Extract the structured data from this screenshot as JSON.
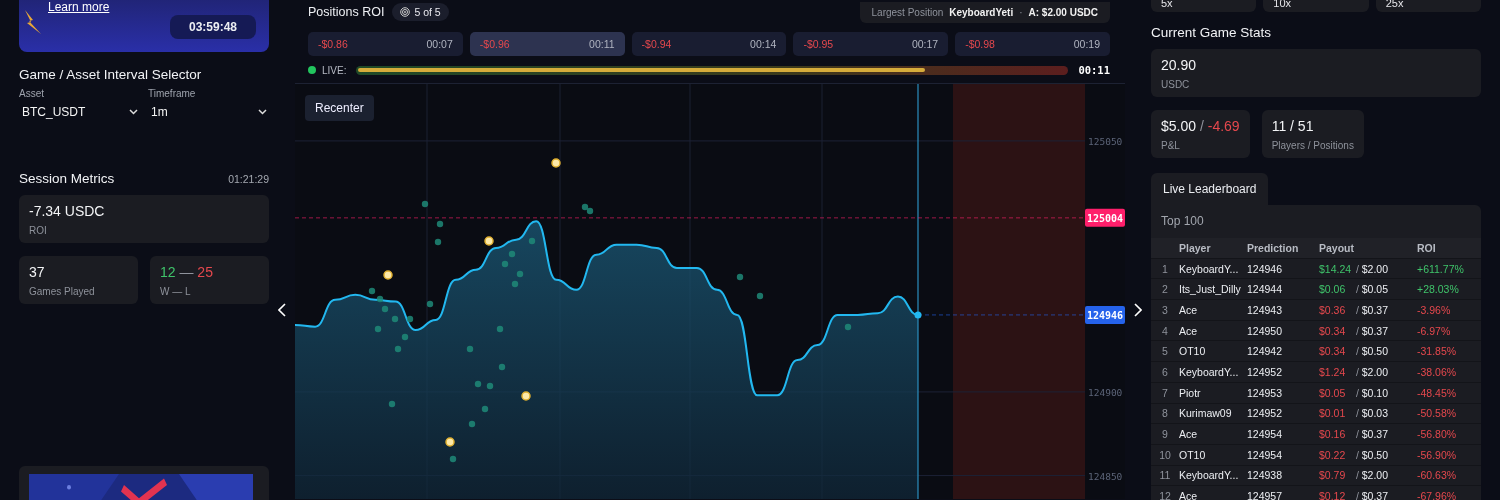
{
  "banner": {
    "link": "Learn more",
    "timer": "03:59:48"
  },
  "selector": {
    "title": "Game / Asset Interval Selector",
    "fields": [
      {
        "label": "Asset",
        "value": "BTC_USDT"
      },
      {
        "label": "Timeframe",
        "value": "1m"
      }
    ]
  },
  "session": {
    "title": "Session Metrics",
    "time": "01:21:29",
    "roi": {
      "value": "-7.34 USDC",
      "label": "ROI"
    },
    "games": {
      "value": "37",
      "label": "Games Played"
    },
    "record": {
      "wins": "12",
      "separator": "—",
      "losses": "25",
      "label": "W — L"
    }
  },
  "positions": {
    "title": "Positions ROI",
    "count": "5 of 5",
    "largest": {
      "label": "Largest Position",
      "player": "KeyboardYeti",
      "separator": "·",
      "amount": "A: $2.00 USDC"
    },
    "cards": [
      {
        "roi": "-$0.86",
        "time": "00:07",
        "profit": false,
        "selected": false
      },
      {
        "roi": "-$0.96",
        "time": "00:11",
        "profit": false,
        "selected": true
      },
      {
        "roi": "-$0.94",
        "time": "00:14",
        "profit": false,
        "selected": false
      },
      {
        "roi": "-$0.95",
        "time": "00:17",
        "profit": false,
        "selected": false
      },
      {
        "roi": "-$0.98",
        "time": "00:19",
        "profit": false,
        "selected": false
      }
    ],
    "live": {
      "label": "LIVE:",
      "level": 0.8,
      "time": "00:11"
    }
  },
  "chart": {
    "button": "Recenter",
    "chart_data": {
      "type": "area",
      "grid": true,
      "ylim": [
        124836,
        125084
      ],
      "yticks": [
        124850,
        124900,
        125050
      ],
      "series": [
        {
          "color": "#22b8f0",
          "values": [
            124940,
            124939,
            124955,
            124958,
            124955,
            124954,
            124937,
            124943,
            124967,
            124973,
            124986,
            124991,
            125002,
            124967,
            124961,
            124982,
            124988,
            124988,
            124986,
            124974,
            124974,
            124961,
            124946,
            124898,
            124898,
            124919,
            124928,
            124946,
            124946,
            124947,
            124957,
            124946
          ]
        }
      ],
      "ref_lines": [
        {
          "axis": "y",
          "value": 125004,
          "label": "125004",
          "color": "#ff1f6b"
        },
        {
          "axis": "y",
          "value": 124946,
          "label": "124946",
          "color": "#2563eb"
        }
      ]
    }
  },
  "multipliers": [
    "5x",
    "10x",
    "25x"
  ],
  "stats": {
    "title": "Current Game Stats",
    "pool": {
      "value": "20.90",
      "label": "USDC"
    },
    "pnl": {
      "stake": "$5.00",
      "separator": "/",
      "result": "-4.69",
      "profit": false,
      "label": "P&L"
    },
    "players": {
      "value": "11 / 51",
      "label": "Players / Positions"
    }
  },
  "leaderboard": {
    "tab": "Live Leaderboard",
    "subtitle": "Top 100",
    "columns": [
      "Player",
      "Prediction",
      "Payout",
      "ROI"
    ],
    "rows": [
      {
        "rank": "1",
        "player": "KeyboardY...",
        "prediction": "124946",
        "payout": "$14.24",
        "separator": "/",
        "stake": "$2.00",
        "roi": "+611.77%",
        "profit": true
      },
      {
        "rank": "2",
        "player": "Its_Just_Dilly",
        "prediction": "124944",
        "payout": "$0.06",
        "separator": "/",
        "stake": "$0.05",
        "roi": "+28.03%",
        "profit": true
      },
      {
        "rank": "3",
        "player": "Ace",
        "prediction": "124943",
        "payout": "$0.36",
        "separator": "/",
        "stake": "$0.37",
        "roi": "-3.96%",
        "profit": false
      },
      {
        "rank": "4",
        "player": "Ace",
        "prediction": "124950",
        "payout": "$0.34",
        "separator": "/",
        "stake": "$0.37",
        "roi": "-6.97%",
        "profit": false
      },
      {
        "rank": "5",
        "player": "OT10",
        "prediction": "124942",
        "payout": "$0.34",
        "separator": "/",
        "stake": "$0.50",
        "roi": "-31.85%",
        "profit": false
      },
      {
        "rank": "6",
        "player": "KeyboardY...",
        "prediction": "124952",
        "payout": "$1.24",
        "separator": "/",
        "stake": "$2.00",
        "roi": "-38.06%",
        "profit": false
      },
      {
        "rank": "7",
        "player": "Piotr",
        "prediction": "124953",
        "payout": "$0.05",
        "separator": "/",
        "stake": "$0.10",
        "roi": "-48.45%",
        "profit": false
      },
      {
        "rank": "8",
        "player": "Kurimaw09",
        "prediction": "124952",
        "payout": "$0.01",
        "separator": "/",
        "stake": "$0.03",
        "roi": "-50.58%",
        "profit": false
      },
      {
        "rank": "9",
        "player": "Ace",
        "prediction": "124954",
        "payout": "$0.16",
        "separator": "/",
        "stake": "$0.37",
        "roi": "-56.80%",
        "profit": false
      },
      {
        "rank": "10",
        "player": "OT10",
        "prediction": "124954",
        "payout": "$0.22",
        "separator": "/",
        "stake": "$0.50",
        "roi": "-56.90%",
        "profit": false
      },
      {
        "rank": "11",
        "player": "KeyboardY...",
        "prediction": "124938",
        "payout": "$0.79",
        "separator": "/",
        "stake": "$2.00",
        "roi": "-60.63%",
        "profit": false
      },
      {
        "rank": "12",
        "player": "Ace",
        "prediction": "124957",
        "payout": "$0.12",
        "separator": "/",
        "stake": "$0.37",
        "roi": "-67.96%",
        "profit": false
      }
    ]
  }
}
